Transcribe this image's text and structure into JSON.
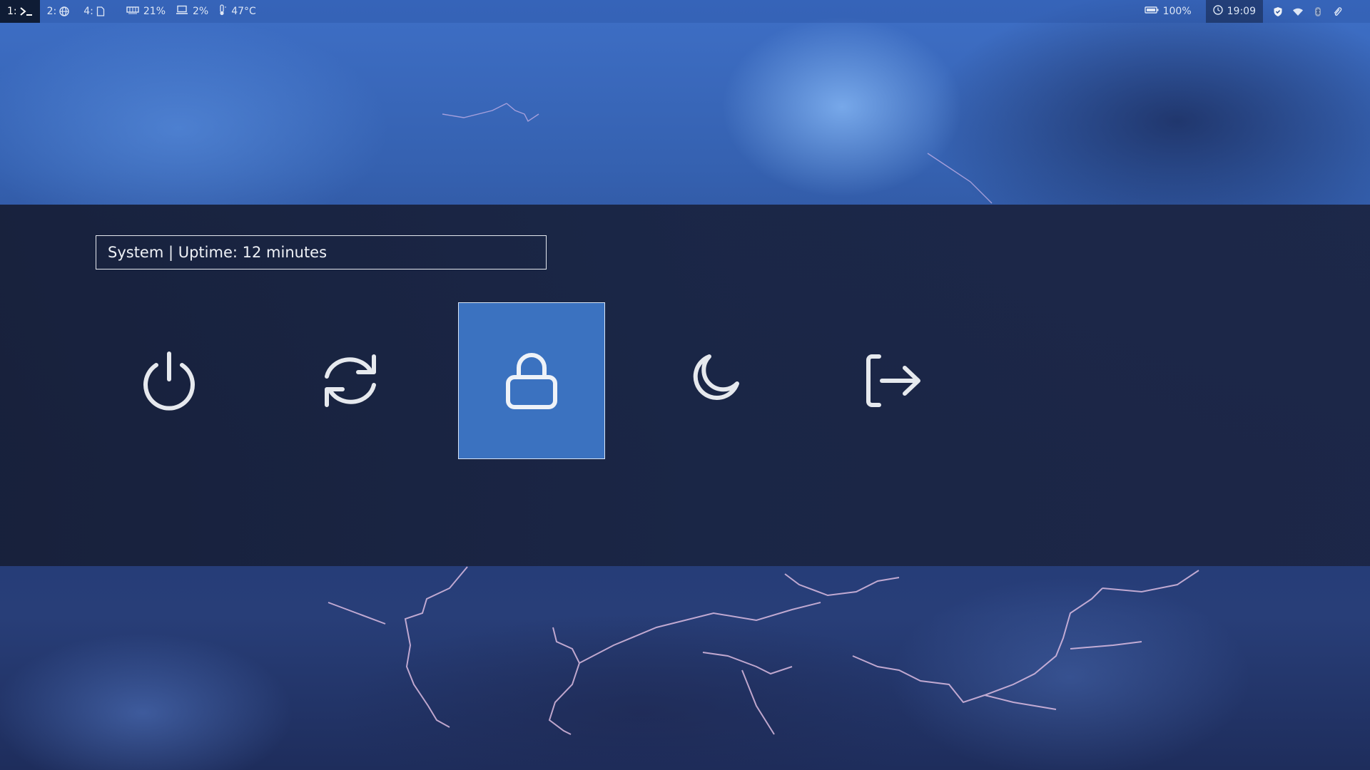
{
  "topbar": {
    "workspaces": [
      {
        "label": "1:",
        "icon": "terminal-icon",
        "active": true
      },
      {
        "label": "2:",
        "icon": "globe-icon",
        "active": false
      },
      {
        "label": "4:",
        "icon": "file-icon",
        "active": false
      }
    ],
    "memory": "21%",
    "cpu": "2%",
    "temperature": "47°C",
    "battery": "100%",
    "clock": "19:09",
    "tray_icons": [
      "shield-icon",
      "wifi-icon",
      "bluetooth-icon",
      "paperclip-icon",
      "flag-de-icon"
    ]
  },
  "powermenu": {
    "prompt": "System | Uptime: 12 minutes",
    "options": [
      {
        "name": "shutdown",
        "icon": "power-icon"
      },
      {
        "name": "reboot",
        "icon": "refresh-icon"
      },
      {
        "name": "lock",
        "icon": "lock-icon",
        "selected": true
      },
      {
        "name": "suspend",
        "icon": "moon-icon"
      },
      {
        "name": "logout",
        "icon": "logout-icon"
      }
    ]
  },
  "colors": {
    "panel_bg": "#1a2544",
    "selected_bg": "#3b72c0",
    "icon_color": "#e6e9ee",
    "active_workspace_bg": "#0f1c35"
  }
}
